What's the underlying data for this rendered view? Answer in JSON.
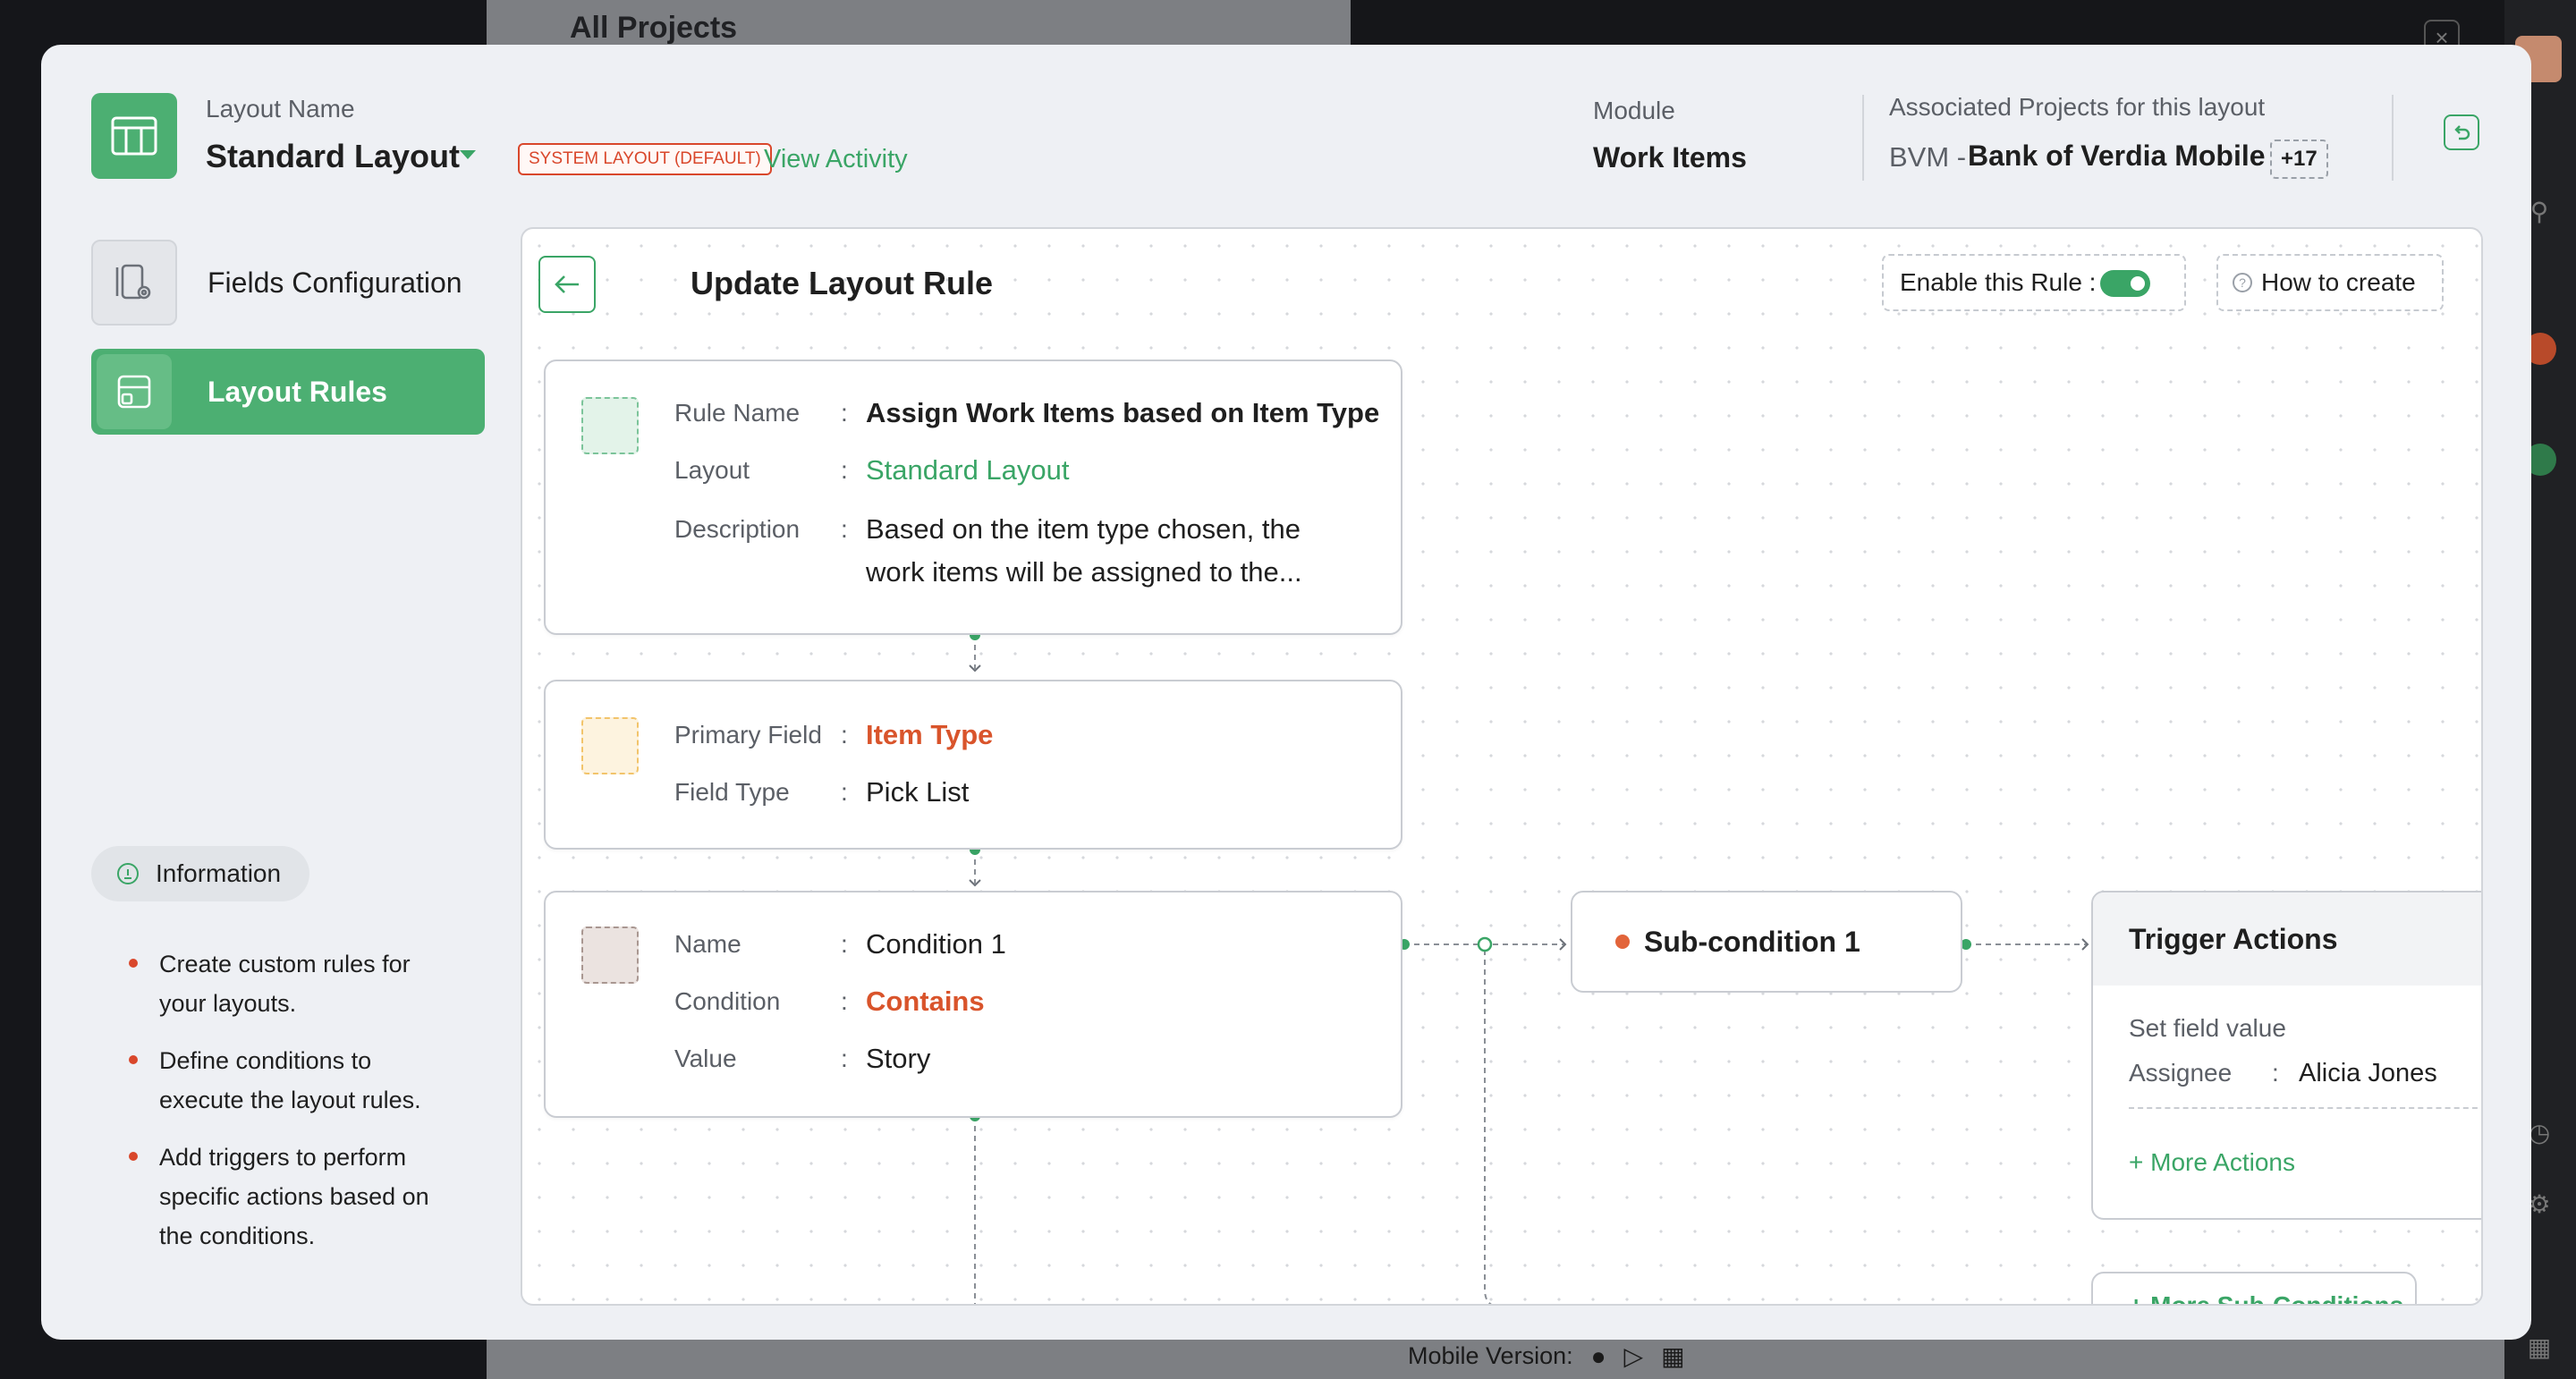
{
  "background": {
    "center_title": "All Projects",
    "mobile_version_label": "Mobile Version:",
    "close_glyph": "×"
  },
  "header": {
    "layout_name_label": "Layout Name",
    "layout_name": "Standard Layout",
    "system_badge": "SYSTEM LAYOUT (DEFAULT)",
    "view_activity": "View Activity",
    "module_label": "Module",
    "module_value": "Work Items",
    "associated_label": "Associated Projects for this layout",
    "associated_code": "BVM -",
    "associated_name": "Bank of Verdia Mobile",
    "associated_more": "+17"
  },
  "sidebar": {
    "items": [
      {
        "label": "Fields Configuration",
        "icon": "fields-config-icon",
        "active": false
      },
      {
        "label": "Layout Rules",
        "icon": "layout-rules-icon",
        "active": true
      }
    ],
    "info_title": "Information",
    "info_points": [
      "Create custom rules for your layouts.",
      "Define conditions to execute the layout rules.",
      "Add triggers to perform specific actions based on the conditions."
    ]
  },
  "panel": {
    "title": "Update Layout Rule",
    "enable_label": "Enable this Rule :",
    "enable_on": true,
    "how_to": "How to create",
    "rule_card": {
      "name_key": "Rule Name",
      "name_value": "Assign Work Items based on Item Type",
      "layout_key": "Layout",
      "layout_value": "Standard Layout",
      "desc_key": "Description",
      "desc_line1": "Based on the item type chosen, the",
      "desc_line2": "work items will be assigned to the..."
    },
    "field_card": {
      "primary_key": "Primary Field",
      "primary_value": "Item Type",
      "type_key": "Field Type",
      "type_value": "Pick List"
    },
    "condition_card": {
      "name_key": "Name",
      "name_value": "Condition 1",
      "cond_key": "Condition",
      "cond_value": "Contains",
      "value_key": "Value",
      "value_value": "Story"
    },
    "sub_condition": "Sub-condition 1",
    "trigger": {
      "title": "Trigger Actions",
      "subtitle": "Set field value",
      "field_key": "Assignee",
      "field_value": "Alicia Jones",
      "more_actions": "+ More Actions"
    },
    "more_sub_conditions": "+ More Sub-Conditions",
    "separator": ":"
  },
  "colors": {
    "accent_green": "#4caf72",
    "link_green": "#3aa566",
    "alert_red": "#d9472b"
  }
}
